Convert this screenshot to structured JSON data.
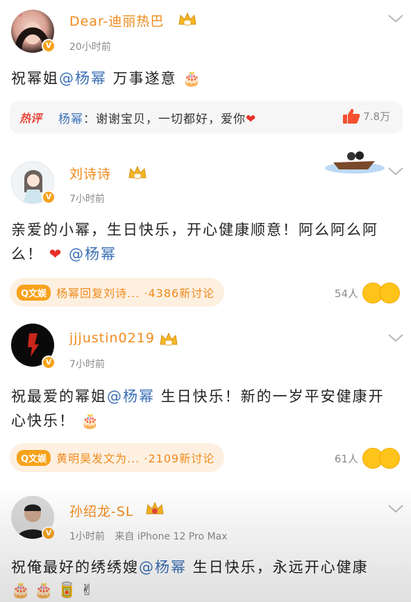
{
  "comments": [
    {
      "username": "Dear-迪丽热巴",
      "time": "20小时前",
      "content_prefix": "祝幂姐",
      "content_mention": "@杨幂",
      "content_suffix": " 万事遂意",
      "hot_reply": {
        "tag": "热评",
        "author": "杨幂",
        "text": "：谢谢宝贝，一切都好，爱你",
        "likes": "7.8万"
      }
    },
    {
      "username": "刘诗诗",
      "time": "7小时前",
      "content_text": "亲爱的小幂，生日快乐，开心健康顺意！阿么阿么阿么！",
      "content_mention": "@杨幂",
      "topic": {
        "tag": "Q文娱",
        "text": "杨幂回复刘诗... ·4386新讨论",
        "people": "54人"
      }
    },
    {
      "username": "jjjustin0219",
      "time": "7小时前",
      "content_prefix": "祝最爱的幂姐",
      "content_mention": "@杨幂",
      "content_suffix": " 生日快乐！新的一岁平安健康开心快乐！",
      "topic": {
        "tag": "Q文娱",
        "text": "黄明昊发文为... ·2109新讨论",
        "people": "61人"
      }
    },
    {
      "username": "孙绍龙-SL",
      "time": "1小时前",
      "source": "来自 iPhone 12 Pro Max",
      "content_prefix": "祝俺最好的绣绣嫂",
      "content_mention": "@杨幂",
      "content_suffix": " 生日快乐，永远开心健康"
    }
  ],
  "colors": {
    "username": "#f08a1c",
    "mention": "#3b6fb6",
    "hot_tag": "#e8473a",
    "badge": "#f7a21b"
  },
  "icons": [
    "crown-icon",
    "verified-badge-icon",
    "chevron-down-icon",
    "thumbs-up-icon",
    "heart-icon",
    "cake-icon",
    "laughing-face-icon",
    "grinning-face-icon",
    "victory-hand-icon",
    "boat-sticker-icon"
  ]
}
